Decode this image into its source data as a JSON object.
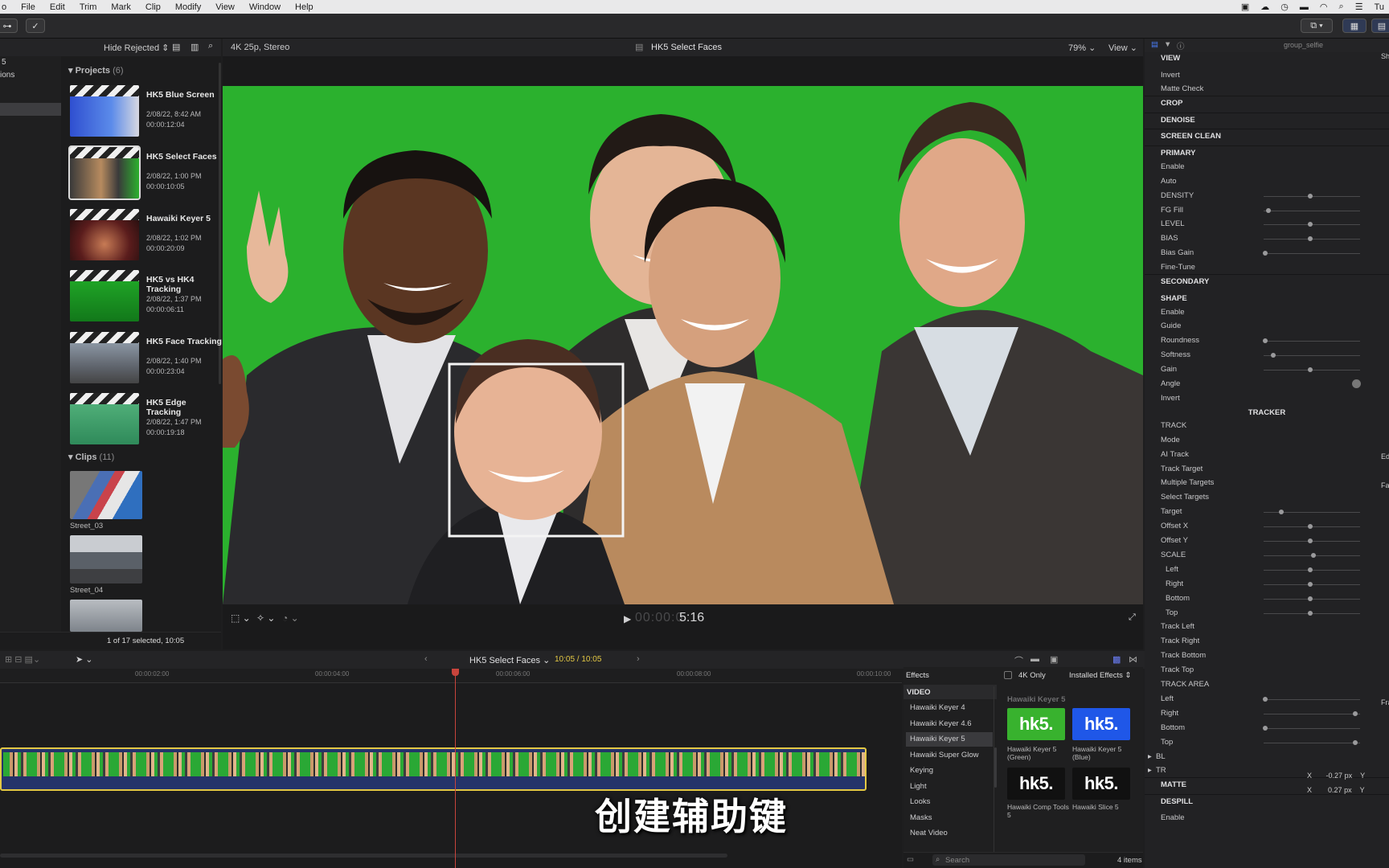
{
  "menubar": {
    "apple": "o",
    "items": [
      "File",
      "Edit",
      "Trim",
      "Mark",
      "Clip",
      "Modify",
      "View",
      "Window",
      "Help"
    ],
    "clock": "Tu"
  },
  "browser": {
    "filter": "Hide Rejected",
    "sidebar_top": "5",
    "sidebar_item": "ions",
    "projects_label": "Projects",
    "projects_count": "(6)",
    "projects": [
      {
        "title": "HK5 Blue Screen",
        "date": "2/08/22, 8:42 AM",
        "dur": "00:00:12:04"
      },
      {
        "title": "HK5 Select Faces",
        "date": "2/08/22, 1:00 PM",
        "dur": "00:00:10:05"
      },
      {
        "title": "Hawaiki Keyer 5",
        "date": "2/08/22, 1:02 PM",
        "dur": "00:00:20:09"
      },
      {
        "title": "HK5 vs HK4 Tracking",
        "date": "2/08/22, 1:37 PM",
        "dur": "00:00:06:11"
      },
      {
        "title": "HK5 Face Tracking",
        "date": "2/08/22, 1:40 PM",
        "dur": "00:00:23:04"
      },
      {
        "title": "HK5 Edge Tracking",
        "date": "2/08/22, 1:47 PM",
        "dur": "00:00:19:18"
      }
    ],
    "clips_label": "Clips",
    "clips_count": "(11)",
    "clips": [
      {
        "name": "Street_03"
      },
      {
        "name": "Street_04"
      }
    ],
    "status": "1 of 17 selected, 10:05"
  },
  "viewer": {
    "format": "4K 25p, Stereo",
    "title": "HK5 Select Faces",
    "zoom": "79%",
    "view": "View",
    "timecode_dim": "00:00:0",
    "timecode": "5:16"
  },
  "inspector": {
    "clip": "group_selfie",
    "rows": [
      {
        "t": "VIEW",
        "h": 1
      },
      {
        "t": "Invert"
      },
      {
        "t": "Matte Check"
      },
      {
        "t": "CROP",
        "h": 1
      },
      {
        "t": "DENOISE",
        "h": 1
      },
      {
        "t": "SCREEN CLEAN",
        "h": 1
      },
      {
        "t": "PRIMARY",
        "h": 1
      },
      {
        "t": "Enable"
      },
      {
        "t": "Auto"
      },
      {
        "t": "DENSITY"
      },
      {
        "t": "FG Fill"
      },
      {
        "t": "LEVEL"
      },
      {
        "t": "BIAS"
      },
      {
        "t": "Bias Gain"
      },
      {
        "t": "Fine-Tune"
      },
      {
        "t": "SECONDARY",
        "h": 1
      },
      {
        "t": "SHAPE",
        "h": 1
      },
      {
        "t": "Enable"
      },
      {
        "t": "Guide"
      },
      {
        "t": "Roundness"
      },
      {
        "t": "Softness"
      },
      {
        "t": "Gain"
      },
      {
        "t": "Angle"
      },
      {
        "t": "Invert"
      },
      {
        "t": "TRACKER",
        "h": 1,
        "c": 1
      },
      {
        "t": "TRACK"
      },
      {
        "t": "Mode"
      },
      {
        "t": "AI Track"
      },
      {
        "t": "Track Target"
      },
      {
        "t": "Multiple Targets"
      },
      {
        "t": "Select Targets"
      },
      {
        "t": "Target"
      },
      {
        "t": "Offset X"
      },
      {
        "t": "Offset Y"
      },
      {
        "t": "SCALE"
      },
      {
        "t": "Left",
        "i": 1
      },
      {
        "t": "Right",
        "i": 1
      },
      {
        "t": "Bottom",
        "i": 1
      },
      {
        "t": "Top",
        "i": 1
      },
      {
        "t": "Track Left"
      },
      {
        "t": "Track Right"
      },
      {
        "t": "Track Bottom"
      },
      {
        "t": "Track Top"
      },
      {
        "t": "TRACK AREA"
      },
      {
        "t": "Left"
      },
      {
        "t": "Right"
      },
      {
        "t": "Bottom"
      },
      {
        "t": "Top"
      },
      {
        "t": "BL"
      },
      {
        "t": "TR"
      },
      {
        "t": "MATTE",
        "h": 1
      },
      {
        "t": "DESPILL",
        "h": 1
      },
      {
        "t": "Enable"
      }
    ],
    "right_vals": {
      "view": "Sh",
      "mode": "Ed",
      "track_target": "Fa",
      "track_area": "Fra"
    },
    "bl": {
      "x": "X",
      "xv": "-0.27",
      "unit": "px",
      "y": "Y"
    },
    "tr": {
      "x": "X",
      "xv": "0.27",
      "unit": "px",
      "y": "Y"
    }
  },
  "timeline": {
    "project": "HK5 Select Faces",
    "duration": "10:05 / 10:05",
    "ruler": [
      "00:00:02:00",
      "00:00:04:00",
      "00:00:06:00",
      "00:00:08:00",
      "00:00:10:00"
    ]
  },
  "effects": {
    "title": "Effects",
    "only4k": "4K Only",
    "installed": "Installed Effects",
    "section": "VIDEO",
    "group": "Hawaiki Keyer 5",
    "list": [
      "Hawaiki Keyer 4",
      "Hawaiki Keyer 4.6",
      "Hawaiki Keyer 5",
      "Hawaiki Super Glow",
      "Keying",
      "Light",
      "Looks",
      "Masks",
      "Neat Video"
    ],
    "tiles": [
      {
        "logo": "hk5.",
        "name": "Hawaiki Keyer 5 (Green)",
        "bg": "#38b22e"
      },
      {
        "logo": "hk5.",
        "name": "Hawaiki Keyer 5 (Blue)",
        "bg": "#1f57e8"
      },
      {
        "logo": "hk5.",
        "name": "Hawaiki Comp Tools 5",
        "bg": "#111111"
      },
      {
        "logo": "hk5.",
        "name": "Hawaiki Slice 5",
        "bg": "#111111"
      }
    ],
    "search": "Search",
    "count": "4 items"
  },
  "subtitle": "创建辅助键"
}
